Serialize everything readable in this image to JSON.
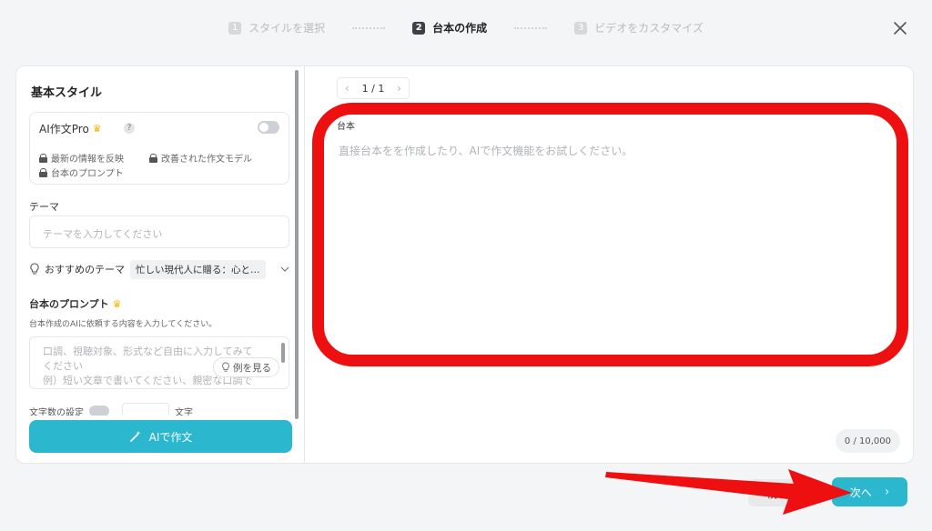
{
  "stepper": {
    "steps": [
      {
        "num": "1",
        "label": "スタイルを選択"
      },
      {
        "num": "2",
        "label": "台本の作成"
      },
      {
        "num": "3",
        "label": "ビデオをカスタマイズ"
      }
    ]
  },
  "left": {
    "title": "基本スタイル",
    "pro": {
      "title": "AI作文Pro",
      "help": "?",
      "features": [
        "最新の情報を反映",
        "改善された作文モデル",
        "台本のプロンプト"
      ],
      "enabled": false
    },
    "theme": {
      "label": "テーマ",
      "placeholder": "テーマを入力してください"
    },
    "recommend": {
      "label": "おすすめのテーマ",
      "value": "忙しい現代人に贈る：心と…"
    },
    "prompt": {
      "title": "台本のプロンプト",
      "description": "台本作成のAIに依頼する内容を入力してください。",
      "placeholder_lines": [
        "口調、視聴対象、形式など自由に入力してみて",
        "ください",
        "例）短い文章で書いてください、親密な口調で"
      ],
      "example_button": "例を見る"
    },
    "char_setting": {
      "label": "文字数の設定",
      "unit": "文字"
    },
    "ai_button": "AIで作文"
  },
  "right": {
    "pager": {
      "prev": "‹",
      "value": "1 / 1",
      "next": "›"
    },
    "script_label": "台本",
    "script_placeholder": "直接台本をを作成したり、AIで作文機能をお試しください。",
    "counter": "0 / 10,000"
  },
  "footer": {
    "prev": "前へ",
    "next": "次へ",
    "next_chevron": "›"
  },
  "colors": {
    "accent": "#2bb8cf",
    "annotation_red": "#ee1010"
  }
}
